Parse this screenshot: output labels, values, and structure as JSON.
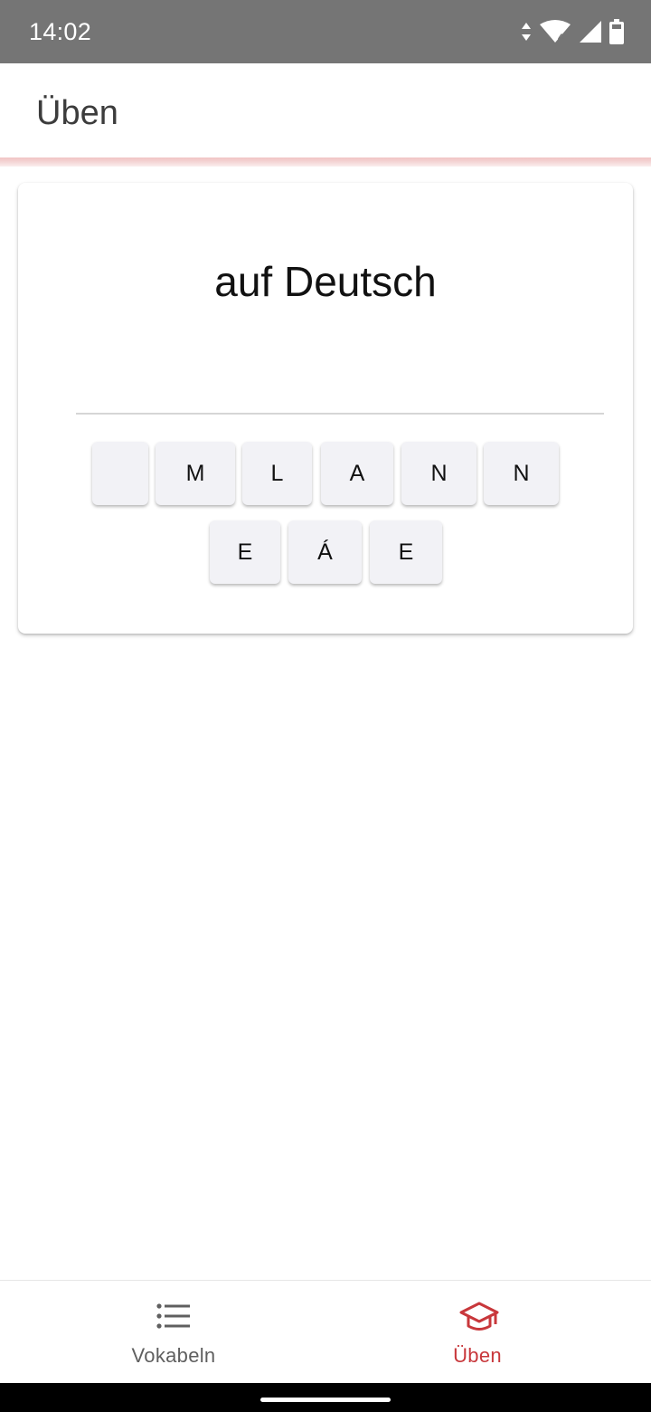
{
  "status_bar": {
    "time": "14:02",
    "icons": [
      "data-arrows-icon",
      "wifi-icon",
      "cell-signal-icon",
      "battery-icon"
    ]
  },
  "app_bar": {
    "title": "Üben"
  },
  "exercise": {
    "prompt": "auf Deutsch",
    "tiles_row1": [
      "",
      "M",
      "L",
      "A",
      "N",
      "N"
    ],
    "tiles_row2": [
      "E",
      "Á",
      "E"
    ]
  },
  "bottom_nav": {
    "items": [
      {
        "label": "Vokabeln",
        "icon": "list-icon",
        "active": false
      },
      {
        "label": "Üben",
        "icon": "graduation-cap-icon",
        "active": true
      }
    ]
  },
  "colors": {
    "accent": "#c8373b",
    "status_bar": "#757575",
    "tile_background": "#f2f2f6",
    "inactive_nav": "#5f5f5f"
  }
}
